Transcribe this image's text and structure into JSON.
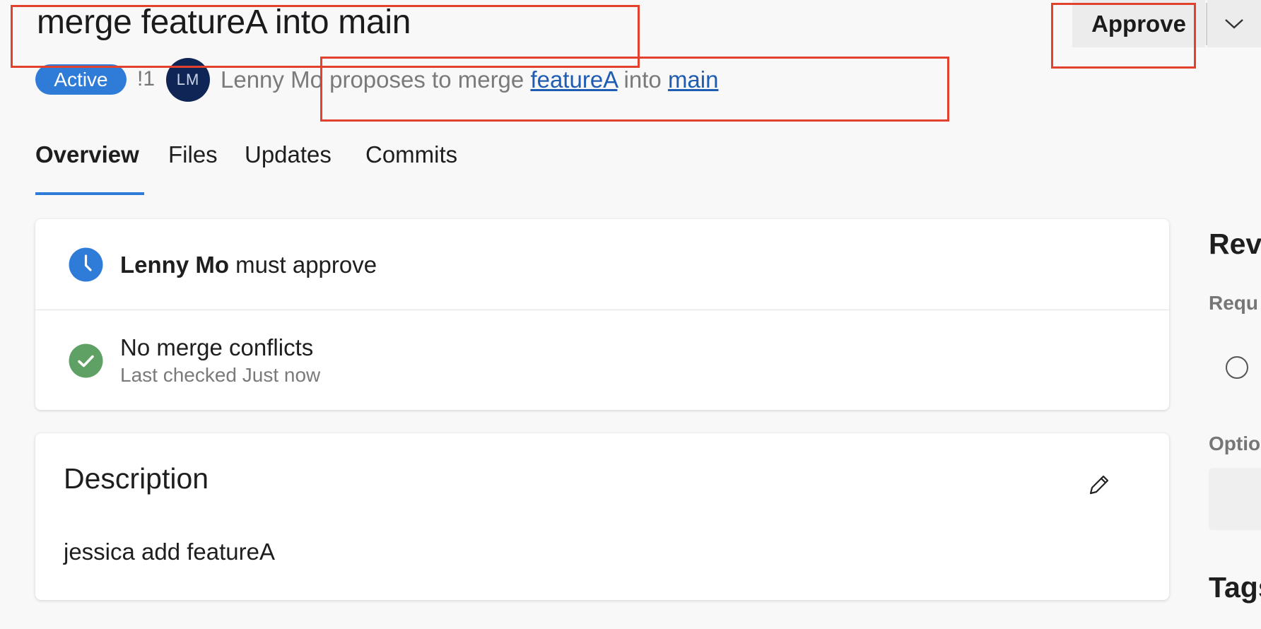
{
  "header": {
    "title": "merge featureA into main",
    "status": "Active",
    "pr_id": "!1",
    "author_initials": "LM",
    "author": "Lenny Mo",
    "proposes_text": "proposes to merge",
    "source_branch": "featureA",
    "into_text": "into",
    "target_branch": "main",
    "approve_label": "Approve",
    "approve_menu_icon": "chevron-down-icon"
  },
  "tabs": [
    {
      "label": "Overview",
      "active": true
    },
    {
      "label": "Files",
      "active": false
    },
    {
      "label": "Updates",
      "active": false
    },
    {
      "label": "Commits",
      "active": false
    }
  ],
  "status_card": {
    "approval": {
      "icon": "clock-icon",
      "reviewer": "Lenny Mo",
      "text": "must approve"
    },
    "conflicts": {
      "icon": "check-circle-icon",
      "title": "No merge conflicts",
      "subtitle": "Last checked Just now"
    }
  },
  "description": {
    "heading": "Description",
    "edit_icon": "pencil-icon",
    "body": "jessica add featureA"
  },
  "sidebar": {
    "reviewers_heading": "Revi",
    "required_label": "Requ",
    "optional_label": "Optio",
    "tags_heading": "Tags"
  },
  "colors": {
    "accent": "#2f7bd8",
    "success": "#5fa164",
    "highlight_box": "#e2412d",
    "avatar_bg": "#0e2556"
  }
}
